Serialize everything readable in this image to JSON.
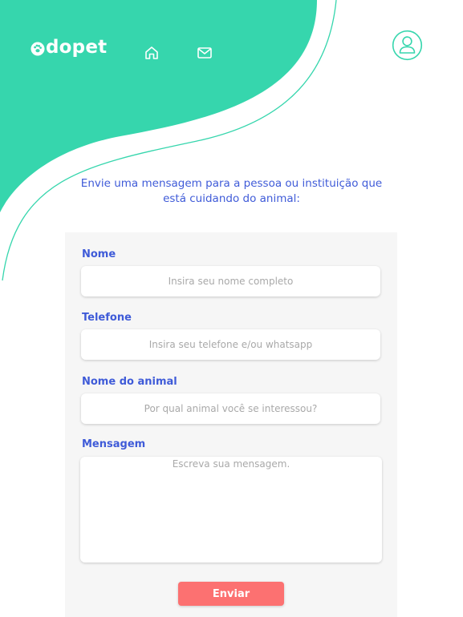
{
  "colors": {
    "brand_teal": "#36d6ad",
    "text_blue": "#3f5bd8",
    "button_coral": "#fc7171",
    "card_gray": "#f6f6f6"
  },
  "header": {
    "logo_text": "dopet",
    "logo_icon": "paw-icon",
    "nav": [
      {
        "name": "home",
        "icon": "home-icon"
      },
      {
        "name": "messages",
        "icon": "mail-icon"
      }
    ],
    "profile_icon": "user-icon"
  },
  "intro": {
    "text": "Envie uma mensagem para a pessoa ou instituição que está cuidando do animal:"
  },
  "form": {
    "fields": [
      {
        "label": "Nome",
        "placeholder": "Insira seu nome completo"
      },
      {
        "label": "Telefone",
        "placeholder": "Insira seu telefone e/ou whatsapp"
      },
      {
        "label": "Nome do animal",
        "placeholder": "Por qual animal você se interessou?"
      },
      {
        "label": "Mensagem",
        "placeholder": "Escreva sua mensagem."
      }
    ],
    "submit_label": "Enviar"
  }
}
